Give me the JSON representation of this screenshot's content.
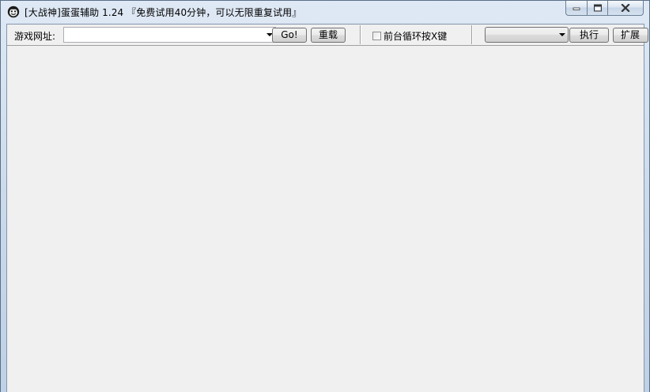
{
  "window": {
    "title": "[大战神]蛋蛋辅助 1.24 『免费试用40分钟，可以无限重复试用』"
  },
  "toolbar": {
    "url_label": "游戏网址:",
    "url_value": "",
    "go_label": "Go!",
    "reload_label": "重载",
    "loop_checkbox_label": "前台循环按X键",
    "loop_checked": false,
    "action_selected": "",
    "exec_label": "执行",
    "extend_label": "扩展"
  },
  "icons": {
    "app": "smiley-face-icon",
    "minimize": "minimize-icon",
    "maximize": "maximize-icon",
    "close": "close-icon",
    "dropdown": "chevron-down-icon"
  }
}
